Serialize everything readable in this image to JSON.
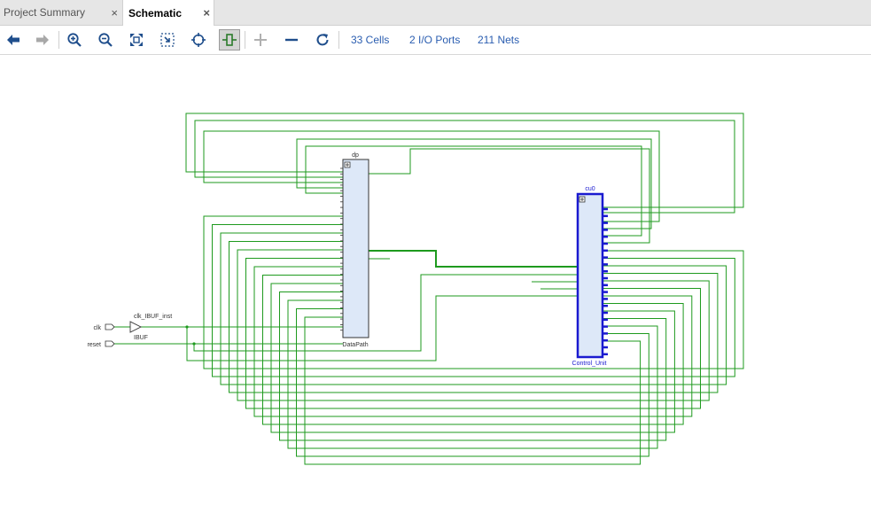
{
  "tabs": [
    {
      "label": "Project Summary",
      "close": "×"
    },
    {
      "label": "Schematic",
      "close": "×"
    }
  ],
  "toolbar": {
    "buttons": [
      "back-arrow-icon",
      "forward-arrow-icon",
      "zoom-in-icon",
      "zoom-out-icon",
      "fit-view-icon",
      "zoom-area-icon",
      "crosshair-icon",
      "routing-toggle-icon",
      "add-icon",
      "remove-icon",
      "refresh-icon"
    ],
    "cells": "33 Cells",
    "io_ports": "2 I/O Ports",
    "nets": "211 Nets"
  },
  "schematic": {
    "port_clk": "clk",
    "port_reset": "reset",
    "ibuf_instance": "clk_IBUF_inst",
    "ibuf_type": "IBUF",
    "dp_instance": "dp",
    "dp_type": "DataPath",
    "cu_instance": "cu0",
    "cu_type": "Control_Unit",
    "wire_color": "#1e9a1e",
    "selected_color": "#1a1ad0",
    "block_fill": "#dde8f8"
  }
}
